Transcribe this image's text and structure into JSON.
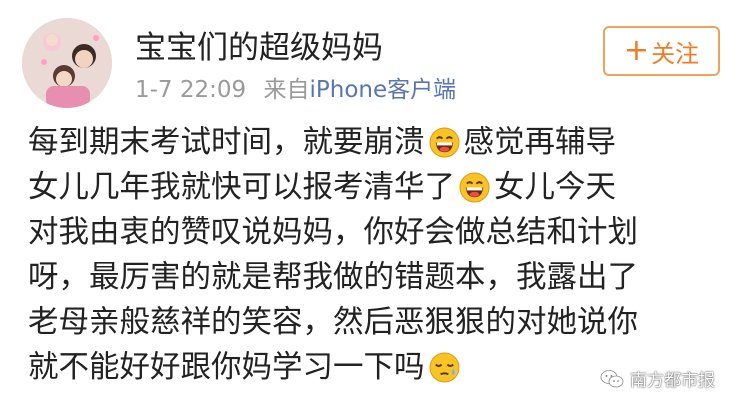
{
  "post": {
    "username": "宝宝们的超级妈妈",
    "time": "1-7 22:09",
    "source_prefix": "来自",
    "source": "iPhone客户端",
    "follow_plus": "+",
    "follow_label": "关注",
    "lines": [
      {
        "a": "每到期末考试时间，就要崩溃",
        "emoji": "grinning-face-emoji",
        "b": "感觉再辅导"
      },
      {
        "a": "女儿几年我就快可以报考清华了",
        "emoji": "grinning-face-emoji",
        "b": "女儿今天"
      },
      {
        "a": "对我由衷的赞叹说妈妈，你好会做总结和计划"
      },
      {
        "a": "呀，最厉害的就是帮我做的错题本，我露出了"
      },
      {
        "a": "老母亲般慈祥的笑容，然后恶狠狠的对她说你"
      },
      {
        "a": "就不能好好跟你妈学习一下吗",
        "emoji": "sleepy-face-emoji"
      }
    ]
  },
  "watermark": {
    "text": "南方都市报",
    "icon": "wechat-icon"
  },
  "colors": {
    "username": "#222222",
    "meta": "#9a9a9a",
    "source_link": "#5a76b1",
    "follow": "#f07d24",
    "follow_border": "#f0a15c"
  }
}
